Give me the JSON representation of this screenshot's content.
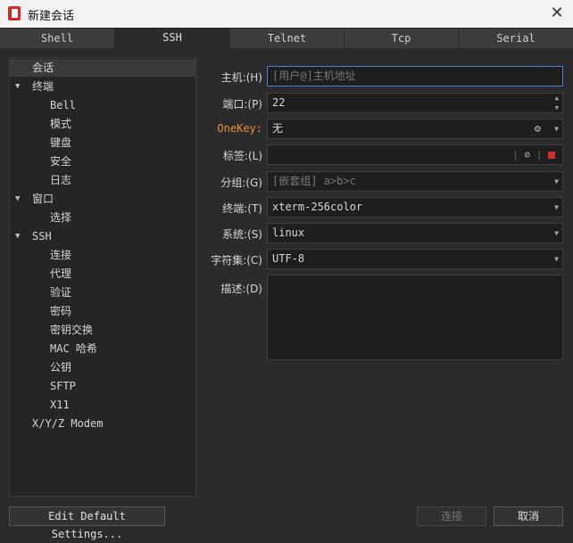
{
  "window": {
    "title": "新建会话"
  },
  "tabs": [
    {
      "label": "Shell",
      "active": false
    },
    {
      "label": "SSH",
      "active": true
    },
    {
      "label": "Telnet",
      "active": false
    },
    {
      "label": "Tcp",
      "active": false
    },
    {
      "label": "Serial",
      "active": false
    }
  ],
  "tree": [
    {
      "label": "会话"
    },
    {
      "label": "终端"
    },
    {
      "label": "Bell"
    },
    {
      "label": "模式"
    },
    {
      "label": "键盘"
    },
    {
      "label": "安全"
    },
    {
      "label": "日志"
    },
    {
      "label": "窗口"
    },
    {
      "label": "选择"
    },
    {
      "label": "SSH"
    },
    {
      "label": "连接"
    },
    {
      "label": "代理"
    },
    {
      "label": "验证"
    },
    {
      "label": "密码"
    },
    {
      "label": "密钥交换"
    },
    {
      "label": "MAC 哈希"
    },
    {
      "label": "公钥"
    },
    {
      "label": "SFTP"
    },
    {
      "label": "X11"
    },
    {
      "label": "X/Y/Z Modem"
    }
  ],
  "form": {
    "host": {
      "label": "主机:(H)",
      "placeholder": "[用户@]主机地址",
      "value": ""
    },
    "port": {
      "label": "端口:(P)",
      "value": "22"
    },
    "onekey": {
      "label": "OneKey:",
      "value": "无"
    },
    "tag": {
      "label": "标签:(L)",
      "value": ""
    },
    "group": {
      "label": "分组:(G)",
      "placeholder": "[嵌套组] a>b>c"
    },
    "terminal": {
      "label": "终端:(T)",
      "value": "xterm-256color"
    },
    "system": {
      "label": "系统:(S)",
      "value": "linux"
    },
    "charset": {
      "label": "字符集:(C)",
      "value": "UTF-8"
    },
    "description": {
      "label": "描述:(D)",
      "value": ""
    }
  },
  "buttons": {
    "edit_defaults": "Edit Default Settings...",
    "connect": "连接",
    "cancel": "取消"
  }
}
